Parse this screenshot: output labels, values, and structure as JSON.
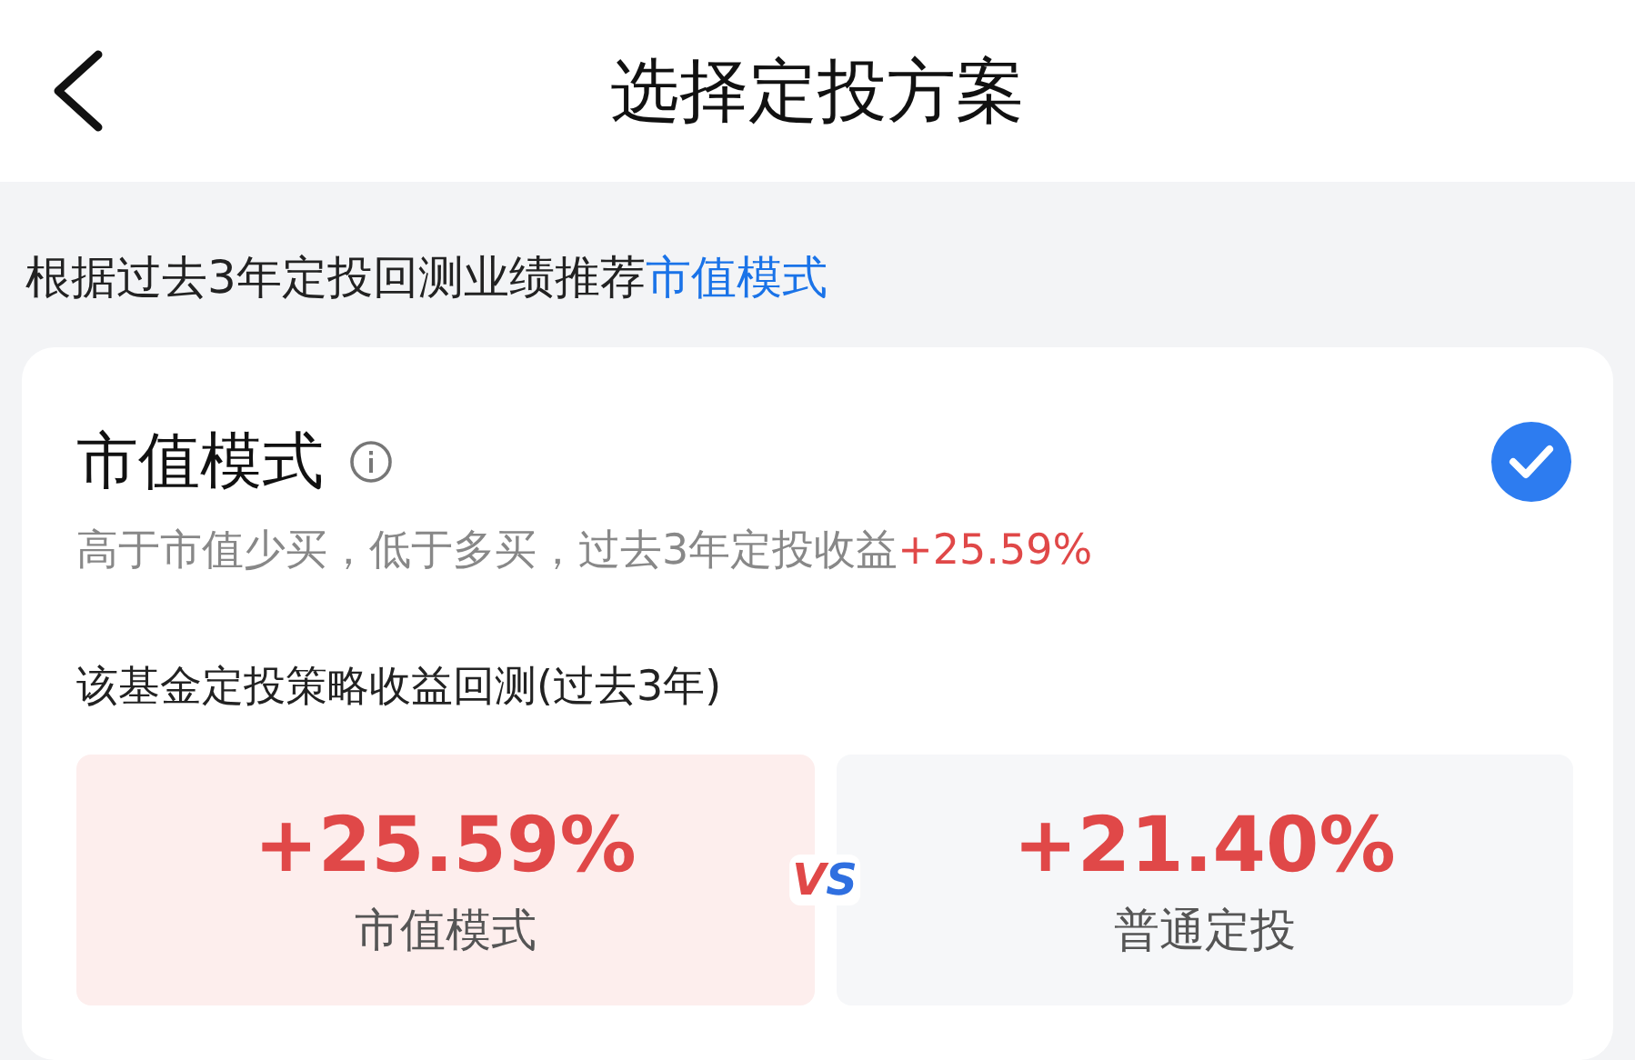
{
  "header": {
    "title": "选择定投方案"
  },
  "recommendation": {
    "text": "根据过去3年定投回测业绩推荐",
    "link": "市值模式"
  },
  "plan": {
    "title": "市值模式",
    "selected": true,
    "description": "高于市值少买，低于多买，过去3年定投收益",
    "return": "+25.59%",
    "backtest_title": "该基金定投策略收益回测(过去3年)",
    "comparison": [
      {
        "value": "+25.59%",
        "label": "市值模式",
        "kind": "highlight"
      },
      {
        "value": "+21.40%",
        "label": "普通定投",
        "kind": "normal"
      }
    ],
    "vs": "VS"
  }
}
